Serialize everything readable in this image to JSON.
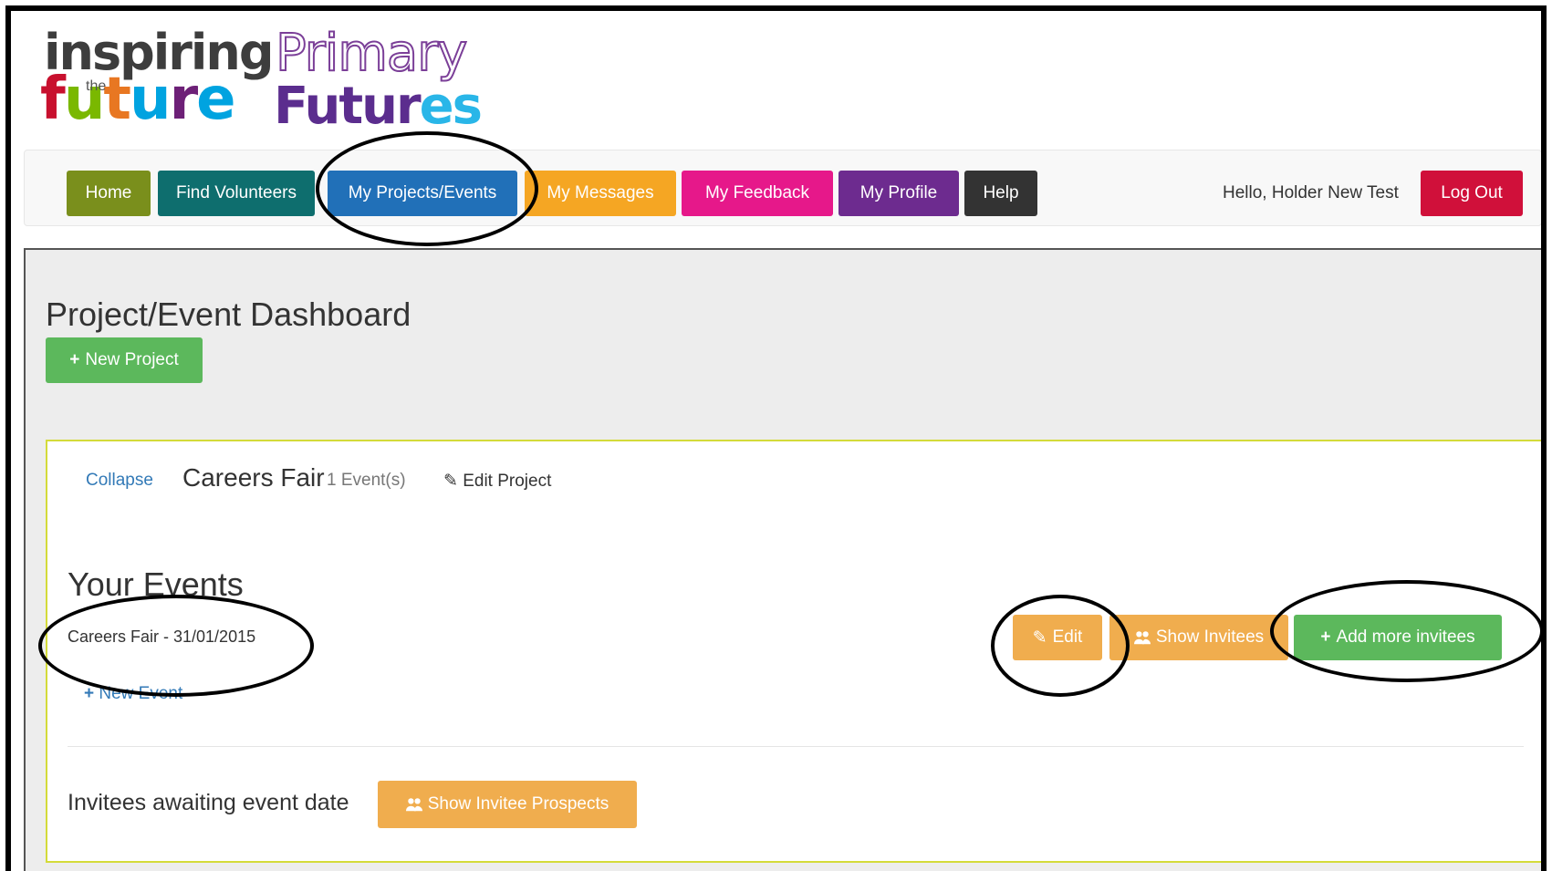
{
  "logos": {
    "inspiring_line1": "inspiring",
    "inspiring_the": "the",
    "inspiring_line2": "future",
    "primary_line1": "Primary",
    "primary_line2": "Futures"
  },
  "nav": {
    "home": "Home",
    "find_volunteers": "Find Volunteers",
    "my_projects": "My Projects/Events",
    "my_messages": "My Messages",
    "my_feedback": "My Feedback",
    "my_profile": "My Profile",
    "help": "Help",
    "greeting": "Hello, Holder New Test",
    "logout": "Log Out"
  },
  "dashboard": {
    "title": "Project/Event Dashboard",
    "new_project": "New Project"
  },
  "project": {
    "collapse": "Collapse",
    "name": "Careers Fair",
    "event_count": "1 Event(s)",
    "edit_project": "Edit Project",
    "events_heading": "Your Events",
    "event_name": "Careers Fair - 31/01/2015",
    "edit": "Edit",
    "show_invitees": "Show Invitees",
    "add_invitees": "Add more invitees",
    "new_event": "New Event",
    "awaiting_label": "Invitees awaiting event date",
    "show_prospects": "Show Invitee Prospects"
  },
  "colors": {
    "home": "#7a8f1c",
    "find_volunteers": "#0e6e6e",
    "my_projects": "#2170b8",
    "my_messages": "#f5a623",
    "my_feedback": "#e6188a",
    "my_profile": "#6d2b8f",
    "help": "#333333",
    "logout": "#d0103a",
    "success": "#5cb85c",
    "warning": "#f0ad4e"
  }
}
